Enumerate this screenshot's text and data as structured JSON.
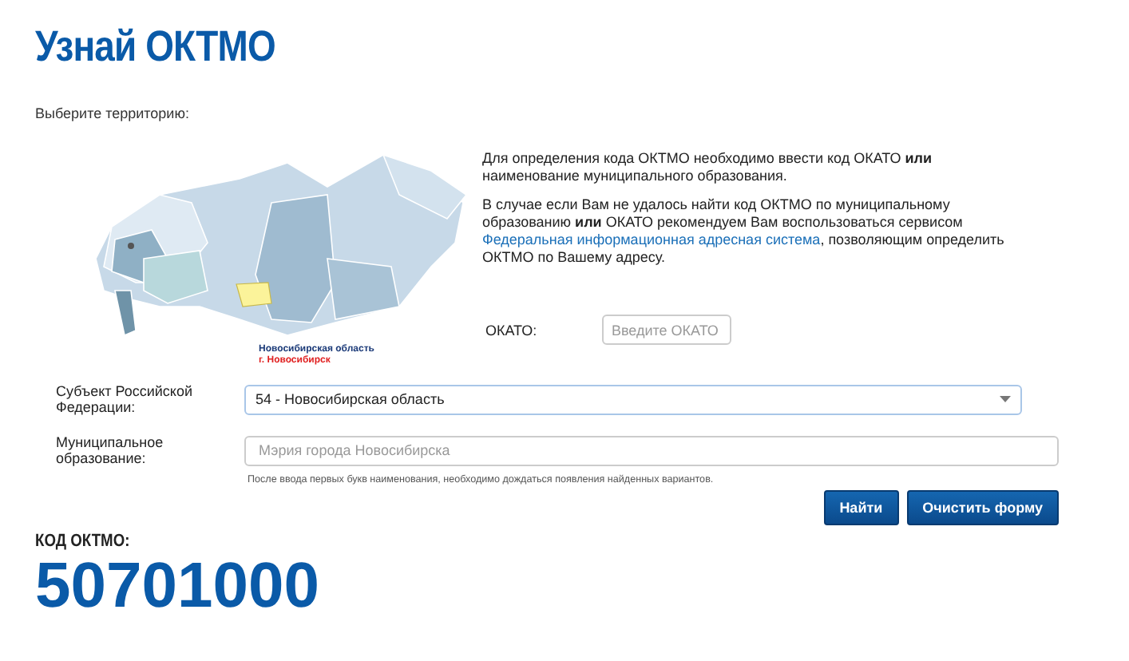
{
  "title": "Узнай ОКТМО",
  "territory_label": "Выберите территорию:",
  "map": {
    "region_label": "Новосибирская область",
    "city_label": "г. Новосибирск"
  },
  "info": {
    "paragraph_1": "Для определения кода ОКТМО необходимо ввести код ОКАТО **или** наименование муниципального образования.",
    "paragraph_2_before": "В случае если Вам не удалось найти код ОКТМО по муниципальному образованию **или** ОКАТО рекомендуем Вам воспользоваться сервисом ",
    "link": "Федеральная информационная адресная система",
    "paragraph_2_after": ", позволяющим определить ОКТМО по Вашему адресу."
  },
  "okato": {
    "label": "ОКАТО:",
    "placeholder": "Введите ОКАТО"
  },
  "subject": {
    "label": "Субъект Российской Федерации:",
    "value": "54 - Новосибирская область"
  },
  "municipality": {
    "label": "Муниципальное образование:",
    "placeholder": "Мэрия города Новосибирска"
  },
  "hint": "После ввода первых букв наименования, необходимо дождаться появления найденных вариантов.",
  "buttons": [
    "Найти",
    "Очистить форму"
  ],
  "result": {
    "label": "КОД ОКТМО:",
    "value": "50701000"
  }
}
